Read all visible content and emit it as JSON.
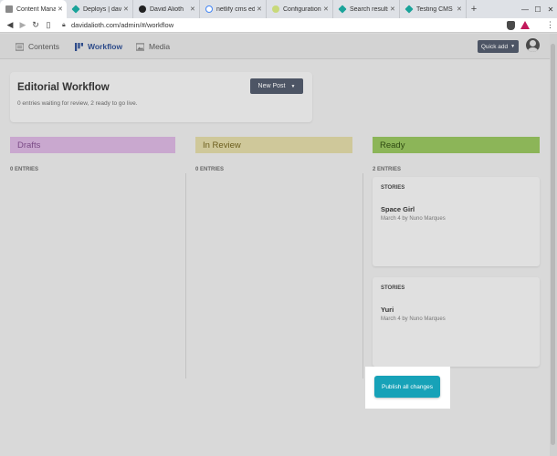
{
  "browser": {
    "tabs": [
      {
        "title": "Content Manage",
        "favicon_color": "#8a8a8a",
        "active": true
      },
      {
        "title": "Deploys | david",
        "favicon_color": "#1aa39a",
        "active": false
      },
      {
        "title": "David Alioth",
        "favicon_color": "#222222",
        "active": false
      },
      {
        "title": "netlify cms edito",
        "favicon_color": "#4285f4",
        "active": false
      },
      {
        "title": "Configuration C",
        "favicon_color": "#c8d97a",
        "active": false
      },
      {
        "title": "Search results fo",
        "favicon_color": "#1aa39a",
        "active": false
      },
      {
        "title": "Testing CMS ho",
        "favicon_color": "#1aa39a",
        "active": false
      }
    ],
    "url": "davidalioth.com/admin/#/workflow"
  },
  "header": {
    "nav": {
      "contents": "Contents",
      "workflow": "Workflow",
      "media": "Media"
    },
    "quick_add": "Quick add"
  },
  "workflow": {
    "title": "Editorial Workflow",
    "subtitle": "0 entries waiting for review, 2 ready to go live.",
    "new_post": "New Post"
  },
  "columns": [
    {
      "title": "Drafts",
      "count": "0 ENTRIES",
      "color": "#c9a8cf",
      "text_color": "#7a4a86"
    },
    {
      "title": "In Review",
      "count": "0 ENTRIES",
      "color": "#cfc89a",
      "text_color": "#6b5d1c"
    },
    {
      "title": "Ready",
      "count": "2 ENTRIES",
      "color": "#8cb558",
      "text_color": "#2f4a12"
    }
  ],
  "entries": [
    {
      "collection": "STORIES",
      "title": "Space Girl",
      "meta": "March 4 by Nuno Marques"
    },
    {
      "collection": "STORIES",
      "title": "Yuri",
      "meta": "March 4 by Nuno Marques"
    }
  ],
  "publish_all": "Publish all changes",
  "colors": {
    "accent": "#17a2b8",
    "button_dark": "#4d5565",
    "nav_active": "#2d4b8a"
  }
}
